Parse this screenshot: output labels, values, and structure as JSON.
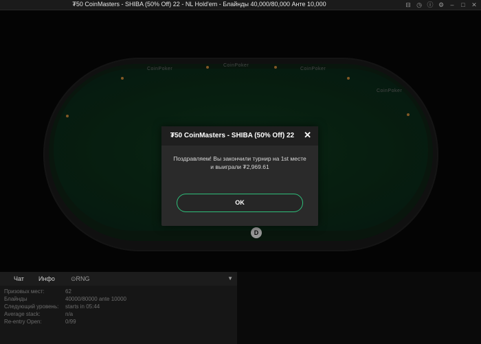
{
  "window": {
    "title": "₮50 CoinMasters - SHIBA (50% Off) 22 - NL Hold'em - Блайнды 40,000/80,000 Анте 10,000",
    "controls": [
      "settings-icon",
      "history-icon",
      "info-icon",
      "gear-icon",
      "minimize-icon",
      "maximize-icon",
      "close-icon"
    ]
  },
  "table": {
    "brand_left": "CoinPoker",
    "brand_center": "CoinPoker",
    "brand_right": "CoinPoker",
    "brand_side": "CoinPoker",
    "dealer_button": "D"
  },
  "modal": {
    "title": "₮50 CoinMasters - SHIBA (50% Off) 22",
    "message": "Поздравляем! Вы закончили турнир на 1st месте и выиграли ₮2,969.61",
    "ok_label": "OK"
  },
  "info_panel": {
    "tabs": [
      "Чат",
      "Инфо",
      "RNG"
    ],
    "rows": [
      {
        "label": "Призовых мест:",
        "value": "62"
      },
      {
        "label": "Блайнды",
        "value": "40000/80000 ante 10000"
      },
      {
        "label": "Следующий уровень:",
        "value": "starts in 05:44"
      },
      {
        "label": "Average stack:",
        "value": "n/a"
      },
      {
        "label": "Re-entry Open:",
        "value": "0/99"
      }
    ]
  },
  "colors": {
    "accent": "#2fc07b",
    "felt": "#0f3a1f",
    "modal_bg": "#2a2a2a"
  }
}
